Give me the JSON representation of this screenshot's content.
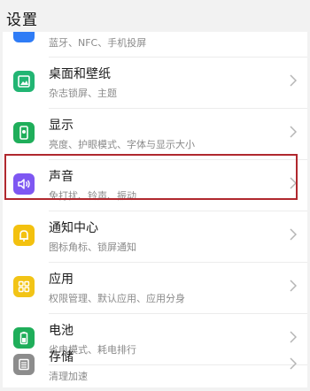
{
  "header": {
    "title": "设置"
  },
  "partial_item": {
    "subtitle": "蓝牙、NFC、手机投屏",
    "icon_color": "#2f7cf6"
  },
  "items": [
    {
      "label": "桌面和壁纸",
      "subtitle": "杂志锁屏、主题",
      "icon": "wallpaper-icon",
      "color": "#22b573"
    },
    {
      "label": "显示",
      "subtitle": "亮度、护眼模式、字体与显示大小",
      "icon": "display-phone-icon",
      "color": "#1fae5a"
    },
    {
      "label": "声音",
      "subtitle": "免打扰、铃声、振动",
      "icon": "speaker-icon",
      "color": "#7e57f2",
      "highlighted": true
    },
    {
      "label": "通知中心",
      "subtitle": "图标角标、锁屏通知",
      "icon": "bell-icon",
      "color": "#f3c10f"
    },
    {
      "label": "应用",
      "subtitle": "权限管理、默认应用、应用分身",
      "icon": "apps-grid-icon",
      "color": "#f2c416"
    },
    {
      "label": "电池",
      "subtitle": "省电模式、耗电排行",
      "icon": "battery-icon",
      "color": "#1fae5a"
    },
    {
      "label": "存储",
      "subtitle": "清理加速",
      "icon": "storage-icon",
      "color": "#8c8c8c"
    }
  ],
  "colors": {
    "highlight_border": "#b0282e",
    "chevron": "#b5b5b5"
  }
}
